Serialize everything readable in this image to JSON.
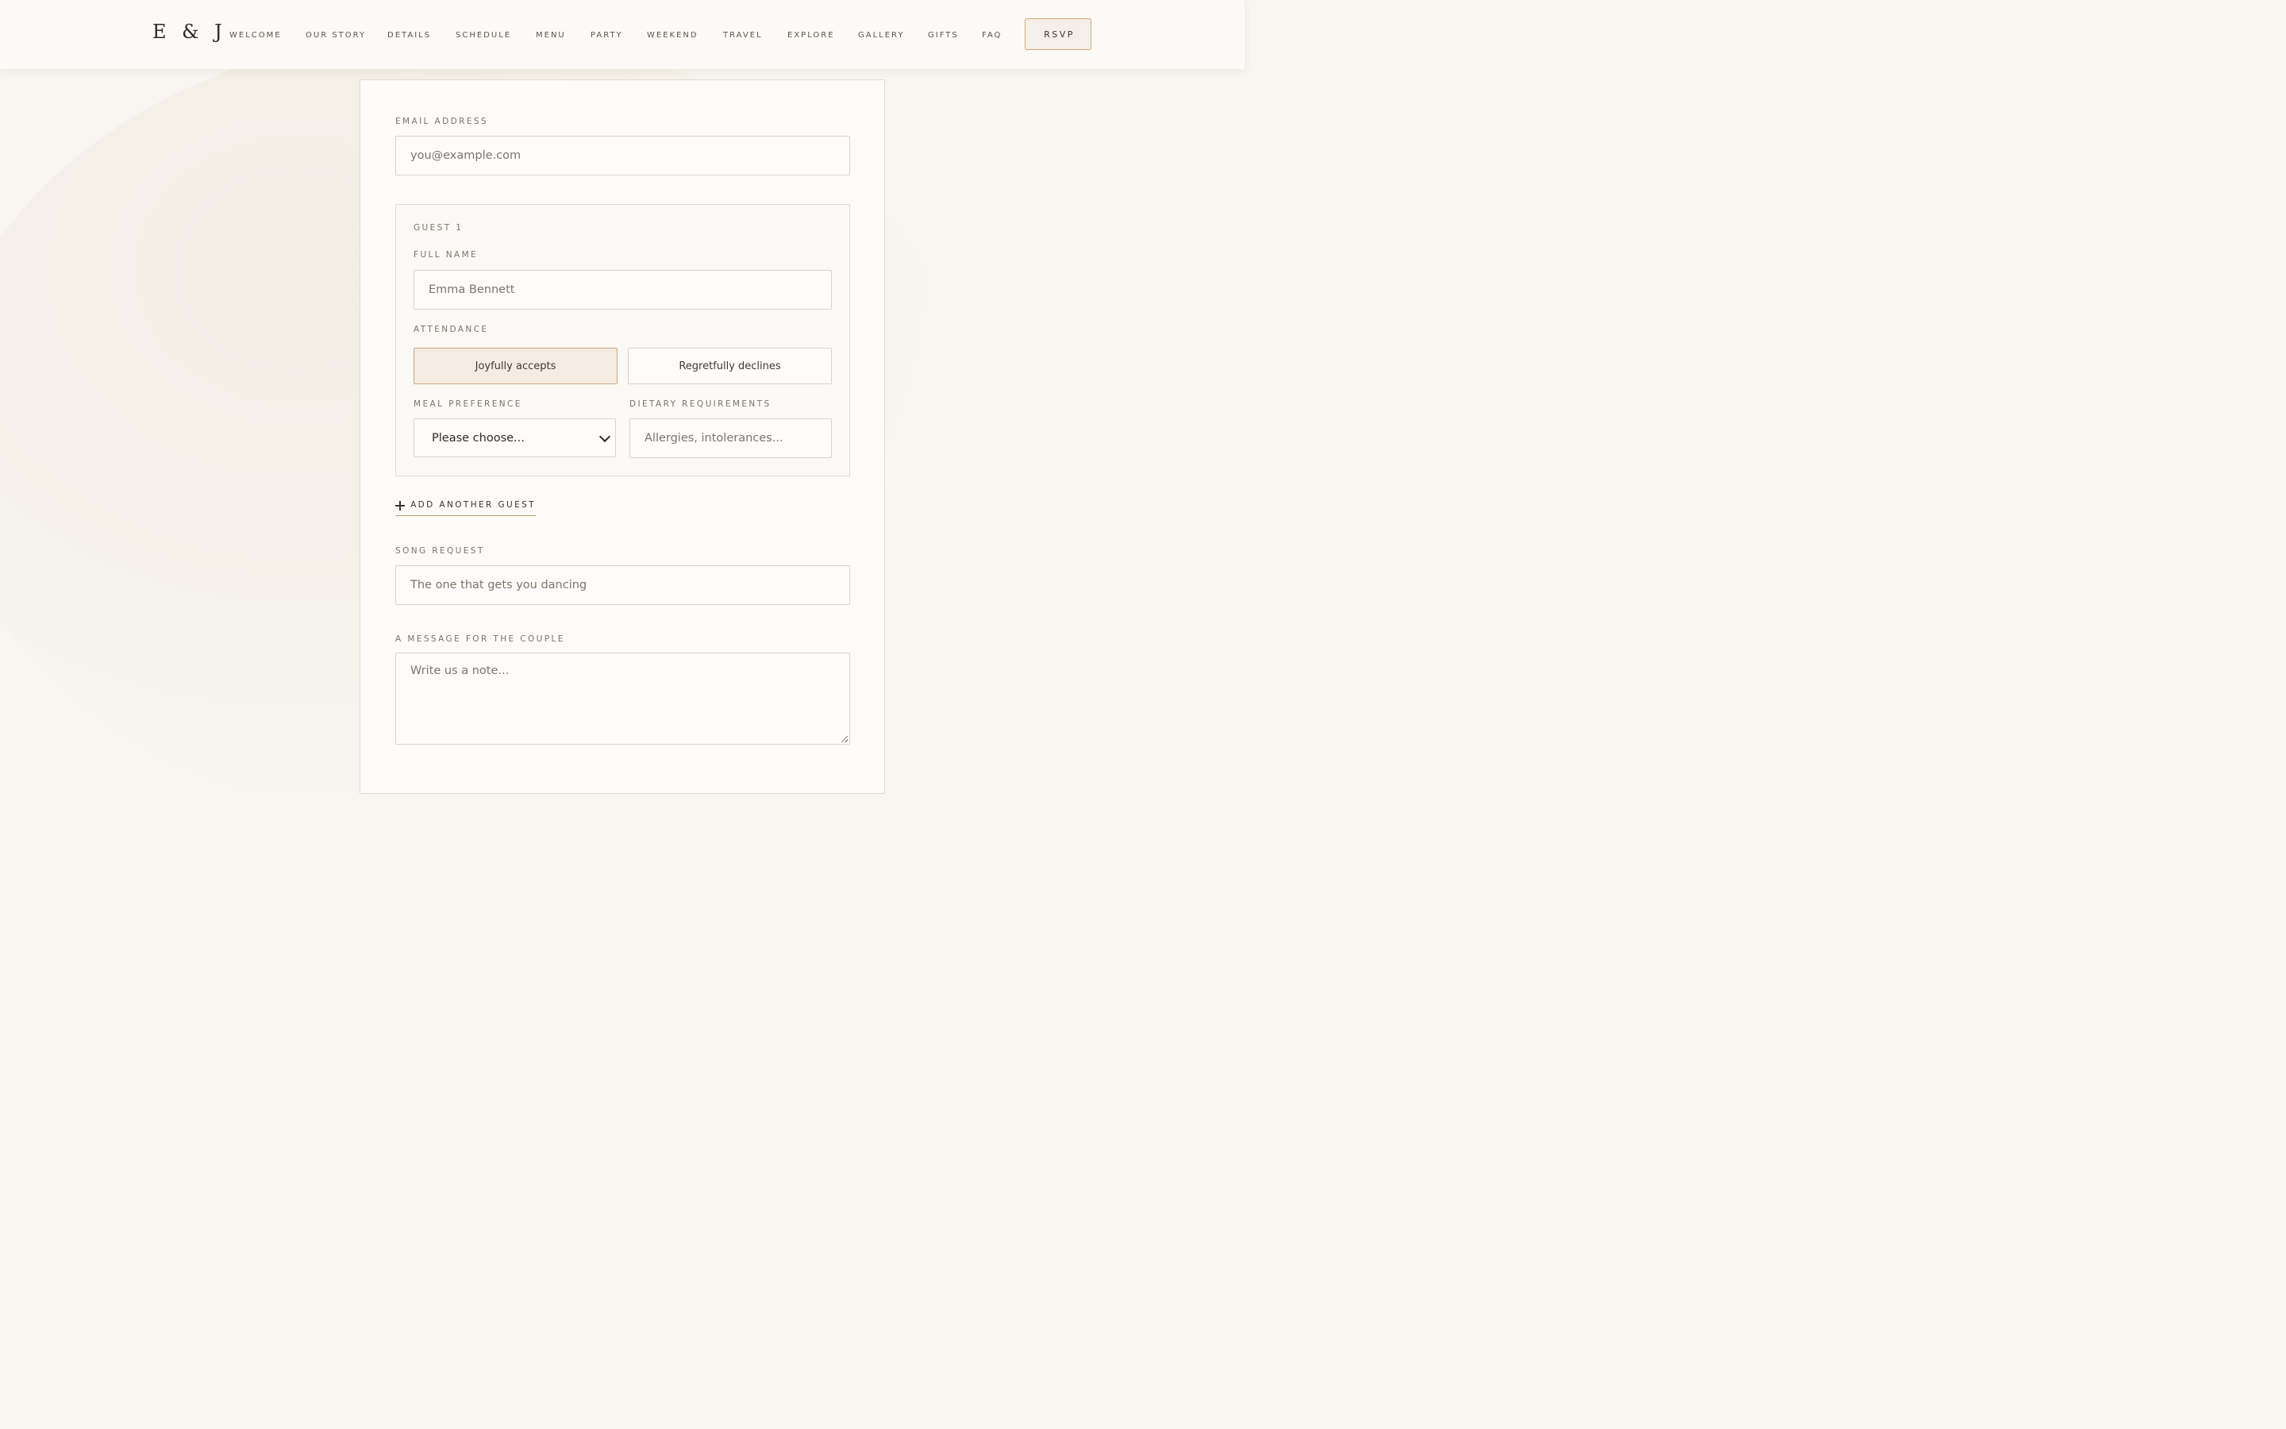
{
  "site": {
    "logo": "E & J"
  },
  "nav": {
    "items": [
      "WELCOME",
      "OUR STORY",
      "DETAILS",
      "SCHEDULE",
      "MENU",
      "PARTY",
      "WEEKEND",
      "TRAVEL",
      "EXPLORE",
      "GALLERY",
      "GIFTS",
      "FAQ"
    ],
    "rsvp_label": "RSVP"
  },
  "form": {
    "email": {
      "label": "EMAIL ADDRESS",
      "placeholder": "you@example.com",
      "value": ""
    },
    "guest": {
      "heading": "GUEST 1",
      "full_name": {
        "label": "FULL NAME",
        "placeholder": "Emma Bennett",
        "value": ""
      },
      "attendance": {
        "label": "ATTENDANCE",
        "options": [
          "Joyfully accepts",
          "Regretfully declines"
        ],
        "selected": "Joyfully accepts"
      },
      "meal": {
        "label": "MEAL PREFERENCE",
        "selected": "Please choose..."
      },
      "dietary": {
        "label": "DIETARY REQUIREMENTS",
        "placeholder": "Allergies, intolerances...",
        "value": ""
      }
    },
    "add_guest_label": "ADD ANOTHER GUEST",
    "song": {
      "label": "SONG REQUEST",
      "placeholder": "The one that gets you dancing",
      "value": ""
    },
    "message": {
      "label": "A MESSAGE FOR THE COUPLE",
      "placeholder": "Write us a note...",
      "value": ""
    }
  },
  "colors": {
    "accent": "#c49a62",
    "selected_bg": "#f4ece2",
    "page_bg": "#f9f6f1"
  }
}
